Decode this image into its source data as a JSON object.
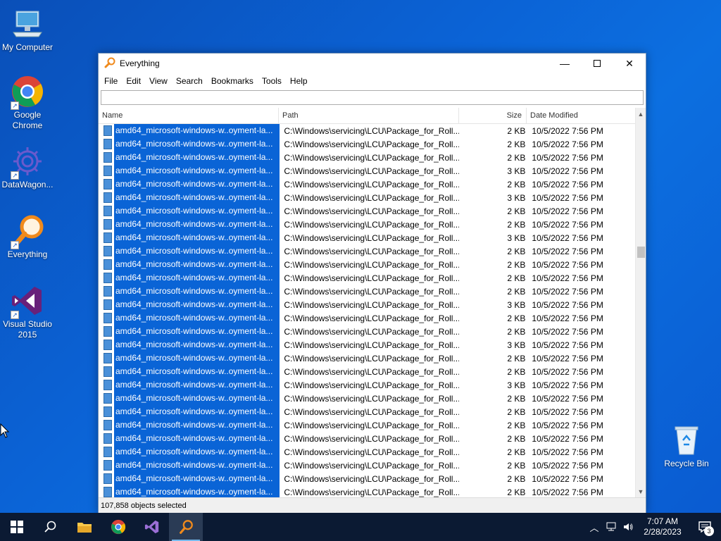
{
  "desktop": {
    "icons": [
      {
        "label": "My Computer"
      },
      {
        "label": "Google Chrome"
      },
      {
        "label": "DataWagon..."
      },
      {
        "label": "Everything"
      },
      {
        "label": "Visual Studio 2015"
      },
      {
        "label": "Recycle Bin"
      }
    ]
  },
  "window": {
    "title": "Everything",
    "menu": [
      "File",
      "Edit",
      "View",
      "Search",
      "Bookmarks",
      "Tools",
      "Help"
    ],
    "search_value": "",
    "columns": {
      "name": "Name",
      "path": "Path",
      "size": "Size",
      "date": "Date Modified"
    },
    "rows": [
      {
        "name": "amd64_microsoft-windows-w..oyment-la...",
        "path": "C:\\Windows\\servicing\\LCU\\Package_for_Roll...",
        "size": "2 KB",
        "date": "10/5/2022 7:56 PM"
      },
      {
        "name": "amd64_microsoft-windows-w..oyment-la...",
        "path": "C:\\Windows\\servicing\\LCU\\Package_for_Roll...",
        "size": "2 KB",
        "date": "10/5/2022 7:56 PM"
      },
      {
        "name": "amd64_microsoft-windows-w..oyment-la...",
        "path": "C:\\Windows\\servicing\\LCU\\Package_for_Roll...",
        "size": "2 KB",
        "date": "10/5/2022 7:56 PM"
      },
      {
        "name": "amd64_microsoft-windows-w..oyment-la...",
        "path": "C:\\Windows\\servicing\\LCU\\Package_for_Roll...",
        "size": "3 KB",
        "date": "10/5/2022 7:56 PM"
      },
      {
        "name": "amd64_microsoft-windows-w..oyment-la...",
        "path": "C:\\Windows\\servicing\\LCU\\Package_for_Roll...",
        "size": "2 KB",
        "date": "10/5/2022 7:56 PM"
      },
      {
        "name": "amd64_microsoft-windows-w..oyment-la...",
        "path": "C:\\Windows\\servicing\\LCU\\Package_for_Roll...",
        "size": "3 KB",
        "date": "10/5/2022 7:56 PM"
      },
      {
        "name": "amd64_microsoft-windows-w..oyment-la...",
        "path": "C:\\Windows\\servicing\\LCU\\Package_for_Roll...",
        "size": "2 KB",
        "date": "10/5/2022 7:56 PM"
      },
      {
        "name": "amd64_microsoft-windows-w..oyment-la...",
        "path": "C:\\Windows\\servicing\\LCU\\Package_for_Roll...",
        "size": "2 KB",
        "date": "10/5/2022 7:56 PM"
      },
      {
        "name": "amd64_microsoft-windows-w..oyment-la...",
        "path": "C:\\Windows\\servicing\\LCU\\Package_for_Roll...",
        "size": "3 KB",
        "date": "10/5/2022 7:56 PM"
      },
      {
        "name": "amd64_microsoft-windows-w..oyment-la...",
        "path": "C:\\Windows\\servicing\\LCU\\Package_for_Roll...",
        "size": "2 KB",
        "date": "10/5/2022 7:56 PM"
      },
      {
        "name": "amd64_microsoft-windows-w..oyment-la...",
        "path": "C:\\Windows\\servicing\\LCU\\Package_for_Roll...",
        "size": "2 KB",
        "date": "10/5/2022 7:56 PM"
      },
      {
        "name": "amd64_microsoft-windows-w..oyment-la...",
        "path": "C:\\Windows\\servicing\\LCU\\Package_for_Roll...",
        "size": "2 KB",
        "date": "10/5/2022 7:56 PM"
      },
      {
        "name": "amd64_microsoft-windows-w..oyment-la...",
        "path": "C:\\Windows\\servicing\\LCU\\Package_for_Roll...",
        "size": "2 KB",
        "date": "10/5/2022 7:56 PM"
      },
      {
        "name": "amd64_microsoft-windows-w..oyment-la...",
        "path": "C:\\Windows\\servicing\\LCU\\Package_for_Roll...",
        "size": "3 KB",
        "date": "10/5/2022 7:56 PM"
      },
      {
        "name": "amd64_microsoft-windows-w..oyment-la...",
        "path": "C:\\Windows\\servicing\\LCU\\Package_for_Roll...",
        "size": "2 KB",
        "date": "10/5/2022 7:56 PM"
      },
      {
        "name": "amd64_microsoft-windows-w..oyment-la...",
        "path": "C:\\Windows\\servicing\\LCU\\Package_for_Roll...",
        "size": "2 KB",
        "date": "10/5/2022 7:56 PM"
      },
      {
        "name": "amd64_microsoft-windows-w..oyment-la...",
        "path": "C:\\Windows\\servicing\\LCU\\Package_for_Roll...",
        "size": "3 KB",
        "date": "10/5/2022 7:56 PM"
      },
      {
        "name": "amd64_microsoft-windows-w..oyment-la...",
        "path": "C:\\Windows\\servicing\\LCU\\Package_for_Roll...",
        "size": "2 KB",
        "date": "10/5/2022 7:56 PM"
      },
      {
        "name": "amd64_microsoft-windows-w..oyment-la...",
        "path": "C:\\Windows\\servicing\\LCU\\Package_for_Roll...",
        "size": "2 KB",
        "date": "10/5/2022 7:56 PM"
      },
      {
        "name": "amd64_microsoft-windows-w..oyment-la...",
        "path": "C:\\Windows\\servicing\\LCU\\Package_for_Roll...",
        "size": "3 KB",
        "date": "10/5/2022 7:56 PM"
      },
      {
        "name": "amd64_microsoft-windows-w..oyment-la...",
        "path": "C:\\Windows\\servicing\\LCU\\Package_for_Roll...",
        "size": "2 KB",
        "date": "10/5/2022 7:56 PM"
      },
      {
        "name": "amd64_microsoft-windows-w..oyment-la...",
        "path": "C:\\Windows\\servicing\\LCU\\Package_for_Roll...",
        "size": "2 KB",
        "date": "10/5/2022 7:56 PM"
      },
      {
        "name": "amd64_microsoft-windows-w..oyment-la...",
        "path": "C:\\Windows\\servicing\\LCU\\Package_for_Roll...",
        "size": "2 KB",
        "date": "10/5/2022 7:56 PM"
      },
      {
        "name": "amd64_microsoft-windows-w..oyment-la...",
        "path": "C:\\Windows\\servicing\\LCU\\Package_for_Roll...",
        "size": "2 KB",
        "date": "10/5/2022 7:56 PM"
      },
      {
        "name": "amd64_microsoft-windows-w..oyment-la...",
        "path": "C:\\Windows\\servicing\\LCU\\Package_for_Roll...",
        "size": "2 KB",
        "date": "10/5/2022 7:56 PM"
      },
      {
        "name": "amd64_microsoft-windows-w..oyment-la...",
        "path": "C:\\Windows\\servicing\\LCU\\Package_for_Roll...",
        "size": "2 KB",
        "date": "10/5/2022 7:56 PM"
      },
      {
        "name": "amd64_microsoft-windows-w..oyment-la...",
        "path": "C:\\Windows\\servicing\\LCU\\Package_for_Roll...",
        "size": "2 KB",
        "date": "10/5/2022 7:56 PM"
      },
      {
        "name": "amd64_microsoft-windows-w..oyment-la...",
        "path": "C:\\Windows\\servicing\\LCU\\Package_for_Roll...",
        "size": "2 KB",
        "date": "10/5/2022 7:56 PM"
      }
    ],
    "status": "107,858 objects selected"
  },
  "taskbar": {
    "clock_time": "7:07 AM",
    "clock_date": "2/28/2023",
    "notification_count": "3"
  },
  "colors": {
    "selection": "#0a64d6",
    "desktop": "#0b63d6",
    "taskbar": "#0b1a33"
  }
}
